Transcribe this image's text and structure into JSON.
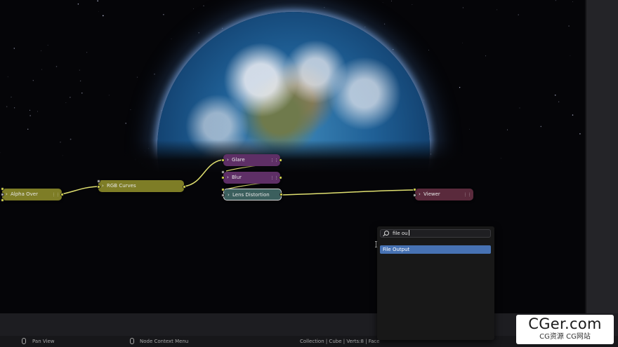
{
  "nodes": [
    {
      "id": "alpha-over",
      "label": "Alpha Over",
      "color": "#7e7d26"
    },
    {
      "id": "rgb-curves",
      "label": "RGB Curves",
      "color": "#7e7d26"
    },
    {
      "id": "glare",
      "label": "Glare",
      "color": "#5e2f66"
    },
    {
      "id": "blur",
      "label": "Blur",
      "color": "#5e2f66"
    },
    {
      "id": "lens-distortion",
      "label": "Lens Distortion",
      "color": "#3b5f5d"
    },
    {
      "id": "viewer",
      "label": "Viewer",
      "color": "#5a2a3c"
    }
  ],
  "search": {
    "query": "file ou",
    "results": [
      {
        "label": "File Output"
      }
    ]
  },
  "statusbar": {
    "pan_view": "Pan View",
    "context_menu": "Node Context Menu",
    "scene_stats": "Collection | Cube | Verts:8 | Face"
  },
  "watermark": {
    "main": "CGer.com",
    "sub": "CG资源 CG网站"
  },
  "colors": {
    "link": "#e0e070",
    "accent": "#4772b3"
  }
}
